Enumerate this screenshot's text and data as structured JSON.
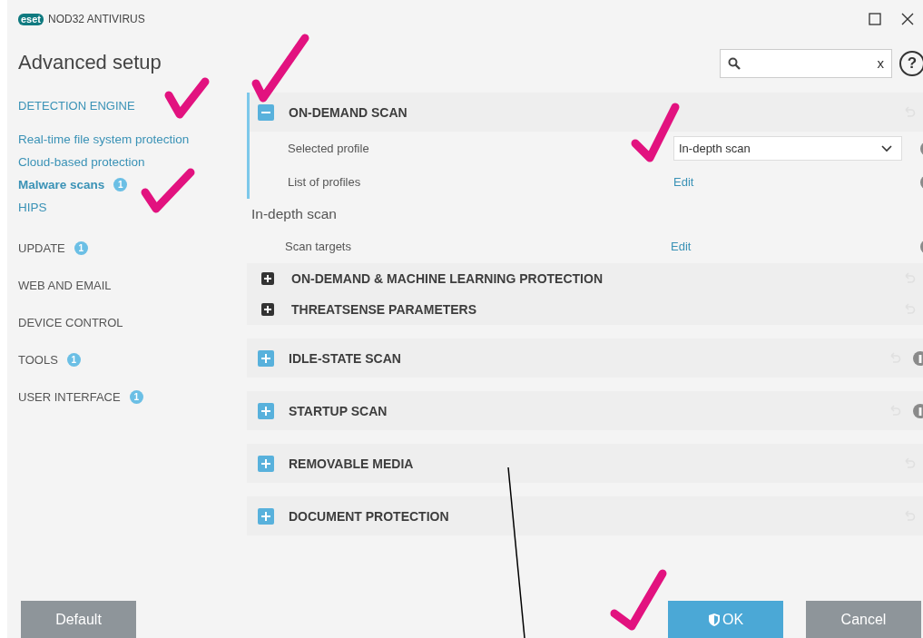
{
  "window": {
    "logo": "eset",
    "title": "NOD32 ANTIVIRUS"
  },
  "heading": "Advanced setup",
  "search": {
    "clear": "x"
  },
  "help": "?",
  "sidebar": [
    {
      "label": "DETECTION ENGINE",
      "selected": true,
      "children": [
        {
          "label": "Real-time file system protection",
          "selected": false
        },
        {
          "label": "Cloud-based protection",
          "selected": false
        },
        {
          "label": "Malware scans",
          "selected": true,
          "badge": "1"
        },
        {
          "label": "HIPS",
          "selected": false
        }
      ]
    },
    {
      "label": "UPDATE",
      "selected": false,
      "badge": "1"
    },
    {
      "label": "WEB AND EMAIL",
      "selected": false
    },
    {
      "label": "DEVICE CONTROL",
      "selected": false
    },
    {
      "label": "TOOLS",
      "selected": false,
      "badge": "1"
    },
    {
      "label": "USER INTERFACE",
      "selected": false,
      "badge": "1"
    }
  ],
  "sections": [
    {
      "title": "ON-DEMAND SCAN",
      "expanded": true,
      "info": false,
      "rows": [
        {
          "label": "Selected profile",
          "kind": "select",
          "value": "In-depth scan"
        },
        {
          "label": "List of profiles",
          "kind": "link",
          "value": "Edit"
        }
      ],
      "subheading": "In-depth scan",
      "sub_rows": [
        {
          "label": "Scan targets",
          "kind": "link",
          "value": "Edit"
        }
      ],
      "subsections": [
        {
          "title": "ON-DEMAND & MACHINE LEARNING PROTECTION",
          "expanded": false
        },
        {
          "title": "THREATSENSE PARAMETERS",
          "expanded": false
        }
      ]
    },
    {
      "title": "IDLE-STATE SCAN",
      "expanded": false,
      "info": true
    },
    {
      "title": "STARTUP SCAN",
      "expanded": false,
      "info": true
    },
    {
      "title": "REMOVABLE MEDIA",
      "expanded": false,
      "info": false
    },
    {
      "title": "DOCUMENT PROTECTION",
      "expanded": false,
      "info": false
    }
  ],
  "buttons": [
    {
      "label": "Default",
      "kind": "secondary"
    },
    {
      "label": "OK",
      "kind": "primary"
    },
    {
      "label": "Cancel",
      "kind": "secondary"
    }
  ]
}
